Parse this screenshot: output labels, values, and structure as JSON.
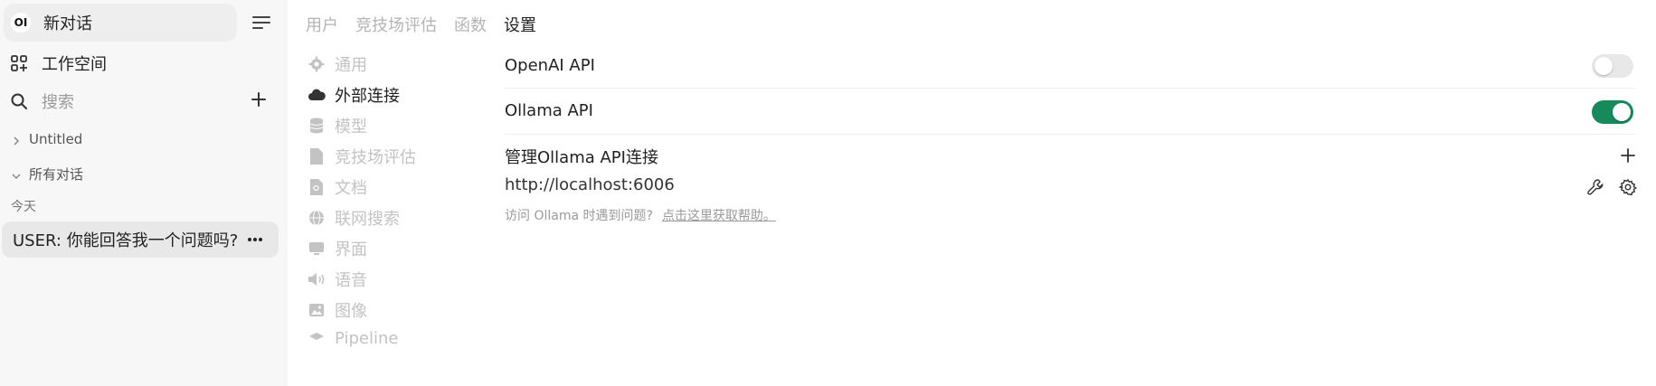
{
  "sidebar": {
    "logo_text": "OI",
    "new_chat_label": "新对话",
    "workspace_label": "工作空间",
    "search_placeholder": "搜索",
    "folders": [
      {
        "label": "Untitled",
        "expanded": false
      },
      {
        "label": "所有对话",
        "expanded": true
      }
    ],
    "today_label": "今天",
    "chats": [
      {
        "title": "USER: 你能回答我一个问题吗?"
      }
    ]
  },
  "top_tabs": [
    {
      "label": "用户",
      "active": false
    },
    {
      "label": "竞技场评估",
      "active": false
    },
    {
      "label": "函数",
      "active": false
    },
    {
      "label": "设置",
      "active": true
    }
  ],
  "settings_nav": [
    {
      "label": "通用",
      "icon": "gear-icon",
      "active": false
    },
    {
      "label": "外部连接",
      "icon": "cloud-icon",
      "active": true
    },
    {
      "label": "模型",
      "icon": "database-icon",
      "active": false
    },
    {
      "label": "竞技场评估",
      "icon": "document-icon",
      "active": false
    },
    {
      "label": "文档",
      "icon": "document-search-icon",
      "active": false
    },
    {
      "label": "联网搜索",
      "icon": "globe-icon",
      "active": false
    },
    {
      "label": "界面",
      "icon": "monitor-icon",
      "active": false
    },
    {
      "label": "语音",
      "icon": "speaker-icon",
      "active": false
    },
    {
      "label": "图像",
      "icon": "image-icon",
      "active": false
    },
    {
      "label": "Pipeline",
      "icon": "pipeline-icon",
      "active": false
    }
  ],
  "connections": {
    "openai_label": "OpenAI API",
    "openai_enabled": false,
    "ollama_label": "Ollama API",
    "ollama_enabled": true,
    "manage_label": "管理Ollama API连接",
    "ollama_url": "http://localhost:6006",
    "help_text": "访问 Ollama 时遇到问题?",
    "help_link": "点击这里获取帮助。"
  },
  "colors": {
    "sidebar_bg": "#f7f7f7",
    "toggle_on": "#168a5a",
    "toggle_off": "#e8e8e8"
  }
}
